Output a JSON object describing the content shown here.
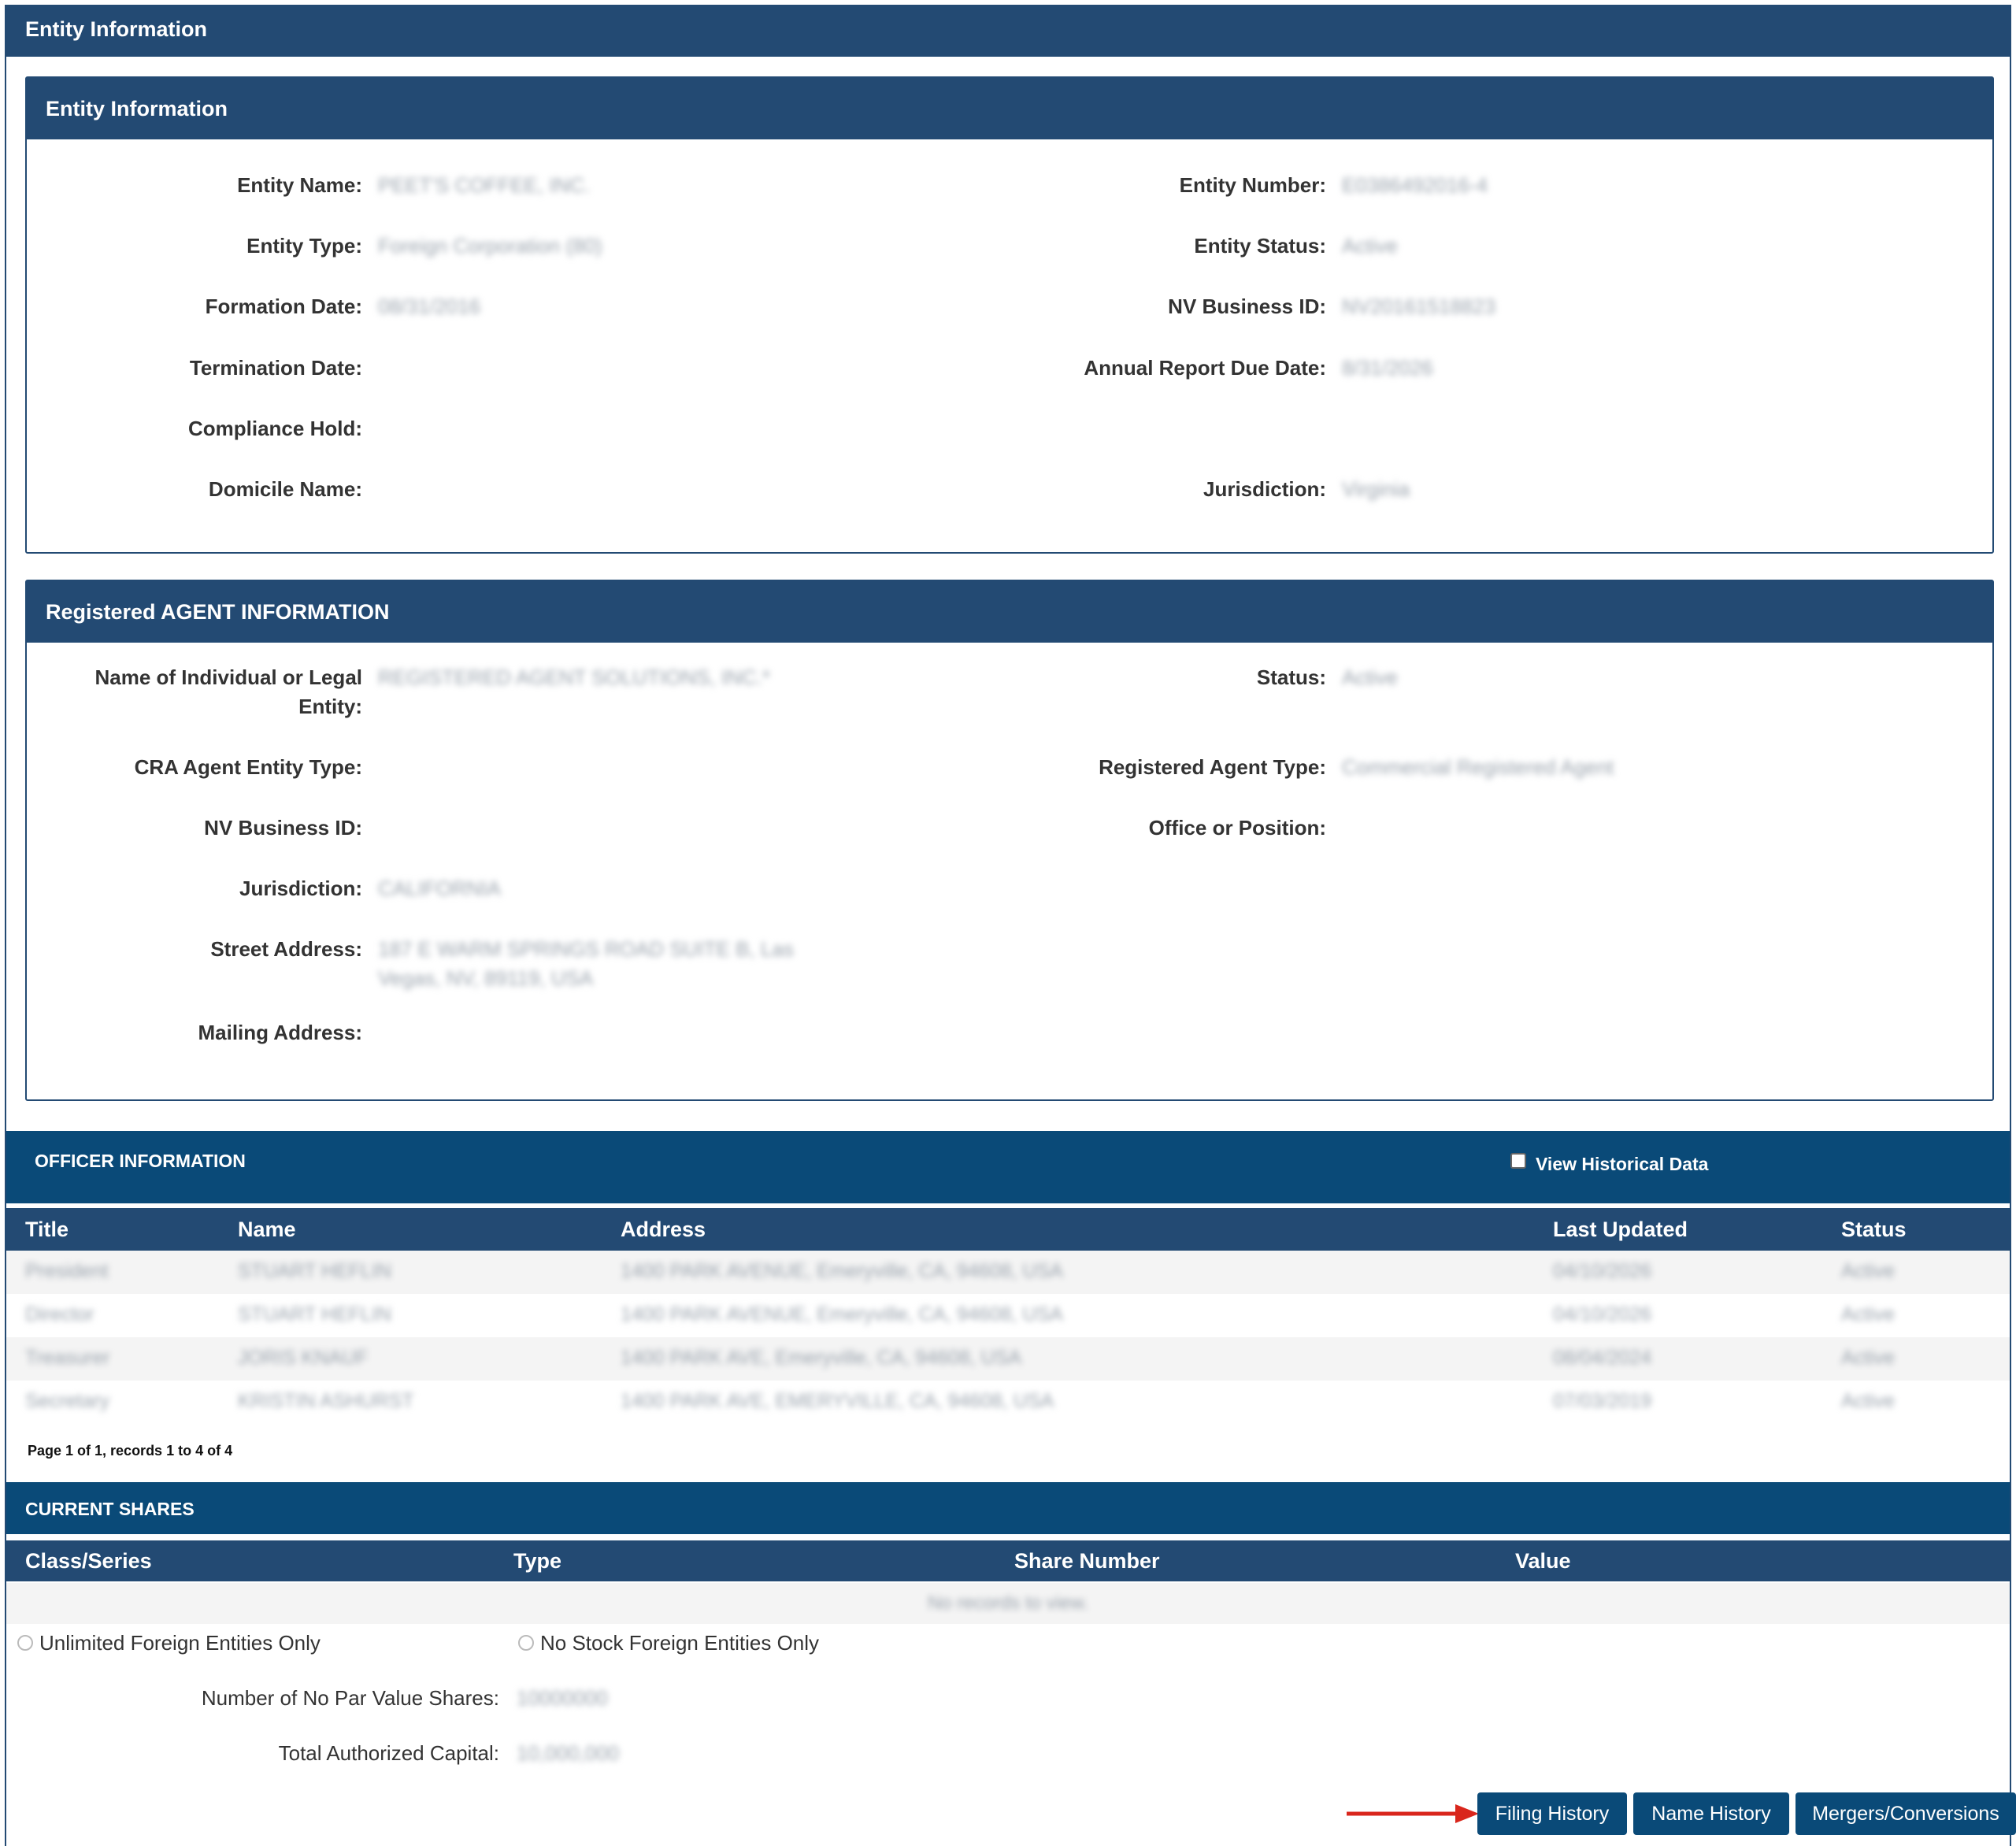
{
  "header": {
    "title": "Entity Information"
  },
  "entity": {
    "title": "Entity Information",
    "fields": {
      "entity_name": {
        "label": "Entity Name:",
        "value": "PEET'S COFFEE, INC."
      },
      "entity_number": {
        "label": "Entity Number:",
        "value": "E0386492016-4"
      },
      "entity_type": {
        "label": "Entity Type:",
        "value": "Foreign Corporation (80)"
      },
      "entity_status": {
        "label": "Entity Status:",
        "value": "Active"
      },
      "formation_date": {
        "label": "Formation Date:",
        "value": "08/31/2016"
      },
      "nv_business_id": {
        "label": "NV Business ID:",
        "value": "NV20161518823"
      },
      "termination_date": {
        "label": "Termination Date:",
        "value": ""
      },
      "annual_report_due": {
        "label": "Annual Report Due Date:",
        "value": "8/31/2026"
      },
      "compliance_hold": {
        "label": "Compliance Hold:",
        "value": ""
      },
      "domicile_name": {
        "label": "Domicile Name:",
        "value": ""
      },
      "jurisdiction": {
        "label": "Jurisdiction:",
        "value": "Virginia"
      }
    }
  },
  "agent": {
    "title": "Registered AGENT INFORMATION",
    "fields": {
      "name": {
        "label": "Name of Individual or Legal Entity:",
        "value": "REGISTERED AGENT SOLUTIONS, INC.*"
      },
      "status": {
        "label": "Status:",
        "value": "Active"
      },
      "cra_type": {
        "label": "CRA Agent Entity Type:",
        "value": ""
      },
      "agent_type": {
        "label": "Registered Agent Type:",
        "value": "Commercial Registered Agent"
      },
      "nv_business_id": {
        "label": "NV Business ID:",
        "value": ""
      },
      "office": {
        "label": "Office or Position:",
        "value": ""
      },
      "jurisdiction": {
        "label": "Jurisdiction:",
        "value": "CALIFORNIA"
      },
      "street": {
        "label": "Street Address:",
        "value": "187 E WARM SPRINGS ROAD SUITE B, Las Vegas, NV, 89119, USA"
      },
      "mailing": {
        "label": "Mailing Address:",
        "value": ""
      }
    }
  },
  "officers": {
    "title": "OFFICER INFORMATION",
    "historical_label": "View Historical Data",
    "columns": [
      "Title",
      "Name",
      "Address",
      "Last Updated",
      "Status"
    ],
    "rows": [
      {
        "title": "President",
        "name": "STUART HEFLIN",
        "address": "1400 PARK AVENUE, Emeryville, CA, 94608, USA",
        "updated": "04/10/2026",
        "status": "Active"
      },
      {
        "title": "Director",
        "name": "STUART HEFLIN",
        "address": "1400 PARK AVENUE, Emeryville, CA, 94608, USA",
        "updated": "04/10/2026",
        "status": "Active"
      },
      {
        "title": "Treasurer",
        "name": "JORIS KNAUF",
        "address": "1400 PARK AVE, Emeryville, CA, 94608, USA",
        "updated": "08/04/2024",
        "status": "Active"
      },
      {
        "title": "Secretary",
        "name": "KRISTIN ASHURST",
        "address": "1400 PARK AVE, EMERYVILLE, CA, 94608, USA",
        "updated": "07/03/2019",
        "status": "Active"
      }
    ],
    "pagination": "Page 1 of 1, records 1 to 4 of 4"
  },
  "shares": {
    "title": "CURRENT SHARES",
    "columns": [
      "Class/Series",
      "Type",
      "Share Number",
      "Value"
    ],
    "empty_text": "No records to view.",
    "radio_unlimited": "Unlimited Foreign Entities Only",
    "radio_no_stock": "No Stock Foreign Entities Only",
    "no_par_label": "Number of No Par Value Shares:",
    "no_par_value": "10000000",
    "total_capital_label": "Total Authorized Capital:",
    "total_capital_value": "10,000,000"
  },
  "buttons": {
    "filing_history": "Filing History",
    "name_history": "Name History",
    "mergers": "Mergers/Conversions"
  },
  "colors": {
    "header_navy": "#234a73",
    "section_blue": "#0a4a78",
    "arrow_red": "#d9261c"
  }
}
